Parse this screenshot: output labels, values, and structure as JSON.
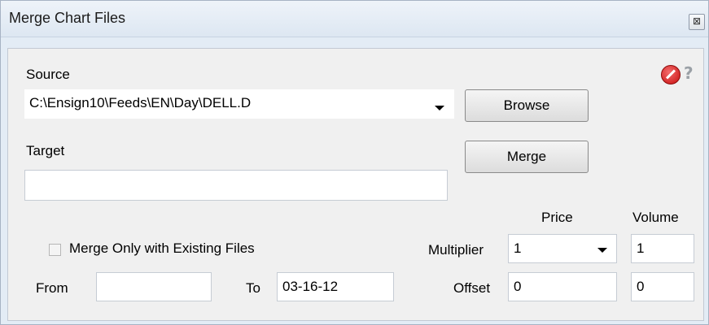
{
  "window": {
    "title": "Merge Chart Files",
    "close_label": "⊠"
  },
  "source": {
    "label": "Source",
    "value": "C:\\Ensign10\\Feeds\\EN\\Day\\DELL.D",
    "browse_label": "Browse"
  },
  "target": {
    "label": "Target",
    "value": "",
    "merge_label": "Merge"
  },
  "options": {
    "merge_existing_label": "Merge Only with Existing Files",
    "merge_existing_checked": false
  },
  "dates": {
    "from_label": "From",
    "from_value": "",
    "to_label": "To",
    "to_value": "03-16-12"
  },
  "grid": {
    "price_header": "Price",
    "volume_header": "Volume",
    "multiplier_label": "Multiplier",
    "offset_label": "Offset",
    "price_multiplier": "1",
    "volume_multiplier": "1",
    "price_offset": "0",
    "volume_offset": "0"
  },
  "icons": {
    "stop": "stop-icon",
    "help": "help-icon",
    "help_glyph": "?"
  }
}
